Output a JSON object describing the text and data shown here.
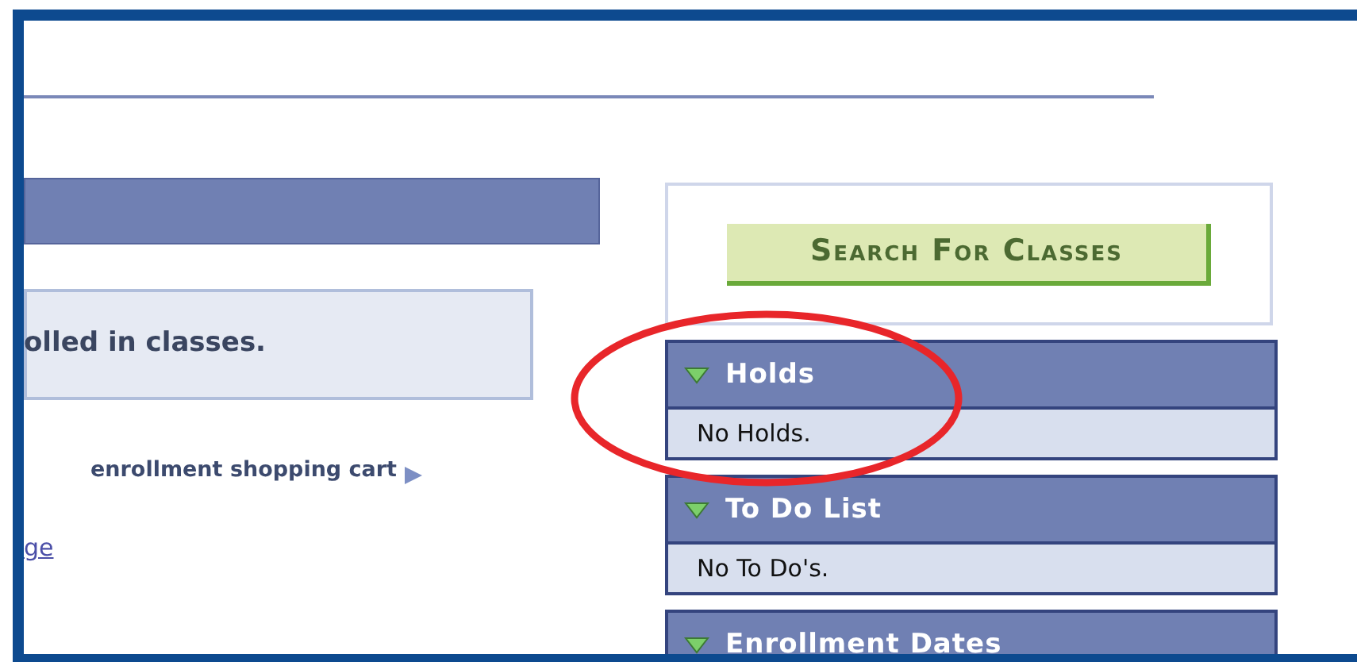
{
  "message": "olled in classes.",
  "shopping_cart_link": "enrollment shopping cart",
  "link": "ge",
  "search_button": "Search For Classes",
  "panels": [
    {
      "title": "Holds",
      "expanded": true,
      "body": "No Holds."
    },
    {
      "title": "To Do List",
      "expanded": true,
      "body": "No To Do's."
    },
    {
      "title": "Enrollment Dates",
      "expanded": true
    }
  ]
}
